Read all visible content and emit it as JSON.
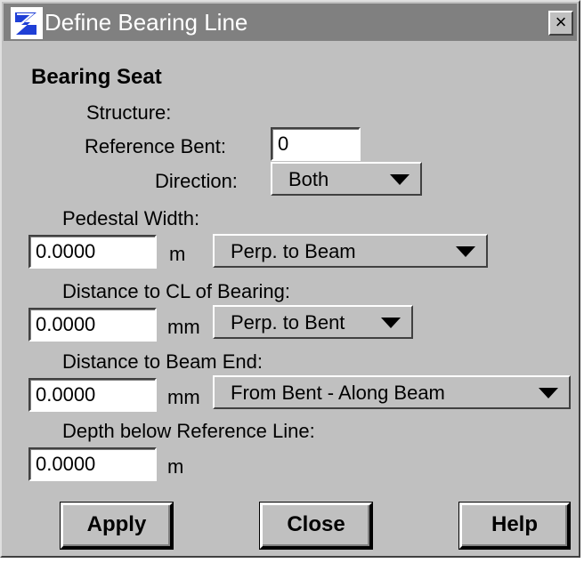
{
  "window": {
    "title": "Define Bearing Line",
    "close_label": "×"
  },
  "section": {
    "title": "Bearing Seat"
  },
  "structure": {
    "label": "Structure:"
  },
  "reference_bent": {
    "label": "Reference Bent:",
    "value": "0"
  },
  "direction": {
    "label": "Direction:",
    "value": "Both"
  },
  "pedestal_width": {
    "label": "Pedestal Width:",
    "value": "0.0000",
    "unit": "m",
    "mode": "Perp. to Beam"
  },
  "distance_cl_bearing": {
    "label": "Distance to CL of Bearing:",
    "value": "0.0000",
    "unit": "mm",
    "mode": "Perp. to Bent"
  },
  "distance_beam_end": {
    "label": "Distance to Beam End:",
    "value": "0.0000",
    "unit": "mm",
    "mode": "From Bent - Along Beam"
  },
  "depth_below_ref": {
    "label": "Depth below Reference Line:",
    "value": "0.0000",
    "unit": "m"
  },
  "buttons": {
    "apply": "Apply",
    "close": "Close",
    "help": "Help"
  },
  "colors": {
    "dialog_bg": "#c0c0c0",
    "titlebar_bg": "#808080",
    "icon_blue": "#1f3fd6"
  }
}
